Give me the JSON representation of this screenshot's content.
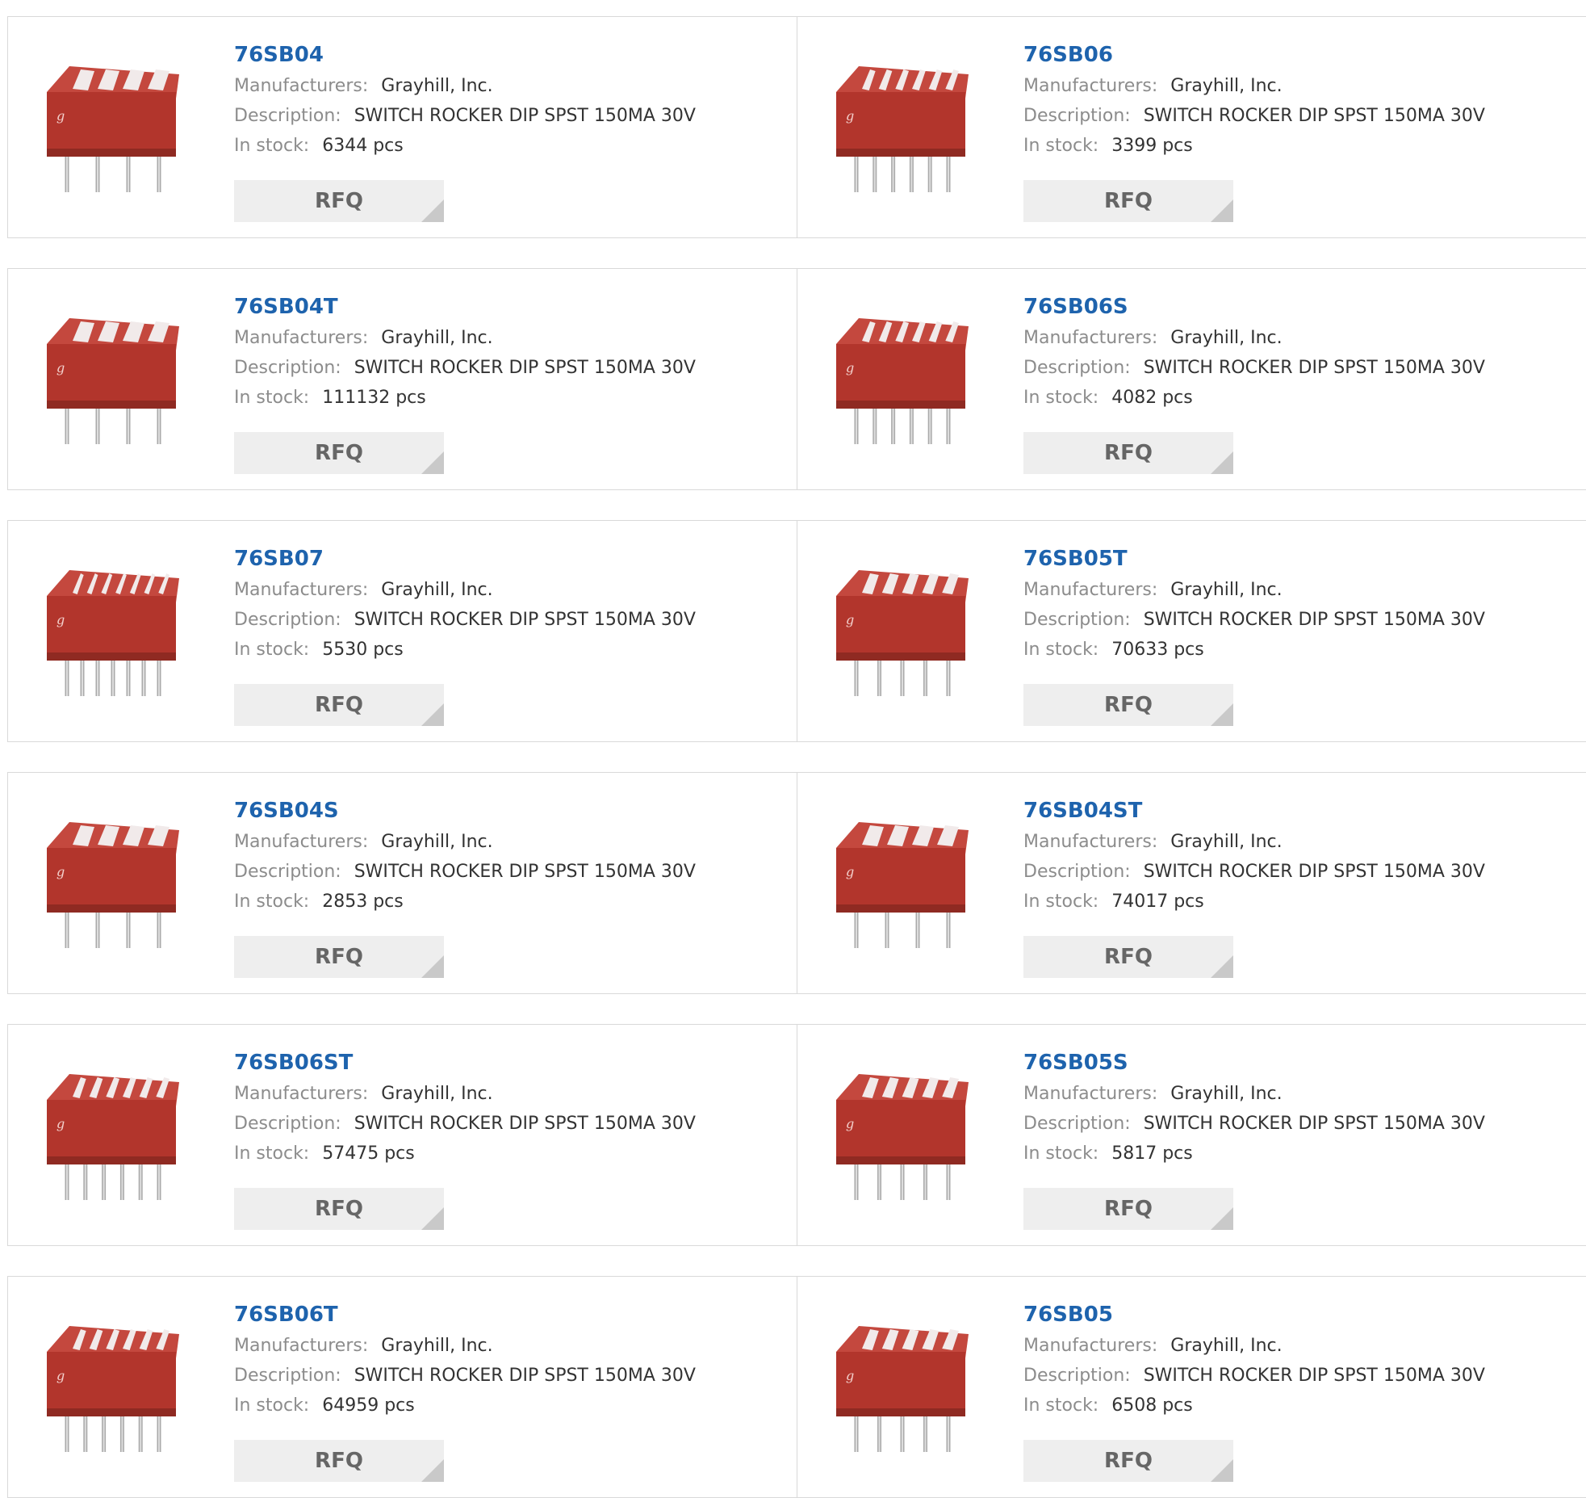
{
  "labels": {
    "manufacturers": "Manufacturers:",
    "description": "Description:",
    "in_stock": "In stock:",
    "rfq": "RFQ"
  },
  "colors": {
    "part_link": "#1e63ad",
    "switch_body": "#b2352c",
    "rfq_bg": "#eeeeee"
  },
  "products": [
    {
      "part": "76SB04",
      "manufacturer": "Grayhill, Inc.",
      "description": "SWITCH ROCKER DIP SPST 150MA 30V",
      "stock": "6344 pcs",
      "switches": 4,
      "image_icon": "dip-switch-icon"
    },
    {
      "part": "76SB06",
      "manufacturer": "Grayhill, Inc.",
      "description": "SWITCH ROCKER DIP SPST 150MA 30V",
      "stock": "3399 pcs",
      "switches": 6,
      "image_icon": "dip-switch-icon"
    },
    {
      "part": "76SB04T",
      "manufacturer": "Grayhill, Inc.",
      "description": "SWITCH ROCKER DIP SPST 150MA 30V",
      "stock": "111132 pcs",
      "switches": 4,
      "image_icon": "dip-switch-icon"
    },
    {
      "part": "76SB06S",
      "manufacturer": "Grayhill, Inc.",
      "description": "SWITCH ROCKER DIP SPST 150MA 30V",
      "stock": "4082 pcs",
      "switches": 6,
      "image_icon": "dip-switch-icon"
    },
    {
      "part": "76SB07",
      "manufacturer": "Grayhill, Inc.",
      "description": "SWITCH ROCKER DIP SPST 150MA 30V",
      "stock": "5530 pcs",
      "switches": 7,
      "image_icon": "dip-switch-icon"
    },
    {
      "part": "76SB05T",
      "manufacturer": "Grayhill, Inc.",
      "description": "SWITCH ROCKER DIP SPST 150MA 30V",
      "stock": "70633 pcs",
      "switches": 5,
      "image_icon": "dip-switch-icon"
    },
    {
      "part": "76SB04S",
      "manufacturer": "Grayhill, Inc.",
      "description": "SWITCH ROCKER DIP SPST 150MA 30V",
      "stock": "2853 pcs",
      "switches": 4,
      "image_icon": "dip-switch-icon"
    },
    {
      "part": "76SB04ST",
      "manufacturer": "Grayhill, Inc.",
      "description": "SWITCH ROCKER DIP SPST 150MA 30V",
      "stock": "74017 pcs",
      "switches": 4,
      "image_icon": "dip-switch-icon"
    },
    {
      "part": "76SB06ST",
      "manufacturer": "Grayhill, Inc.",
      "description": "SWITCH ROCKER DIP SPST 150MA 30V",
      "stock": "57475 pcs",
      "switches": 6,
      "image_icon": "dip-switch-icon"
    },
    {
      "part": "76SB05S",
      "manufacturer": "Grayhill, Inc.",
      "description": "SWITCH ROCKER DIP SPST 150MA 30V",
      "stock": "5817 pcs",
      "switches": 5,
      "image_icon": "dip-switch-icon"
    },
    {
      "part": "76SB06T",
      "manufacturer": "Grayhill, Inc.",
      "description": "SWITCH ROCKER DIP SPST 150MA 30V",
      "stock": "64959 pcs",
      "switches": 6,
      "image_icon": "dip-switch-icon"
    },
    {
      "part": "76SB05",
      "manufacturer": "Grayhill, Inc.",
      "description": "SWITCH ROCKER DIP SPST 150MA 30V",
      "stock": "6508 pcs",
      "switches": 5,
      "image_icon": "dip-switch-icon"
    }
  ]
}
